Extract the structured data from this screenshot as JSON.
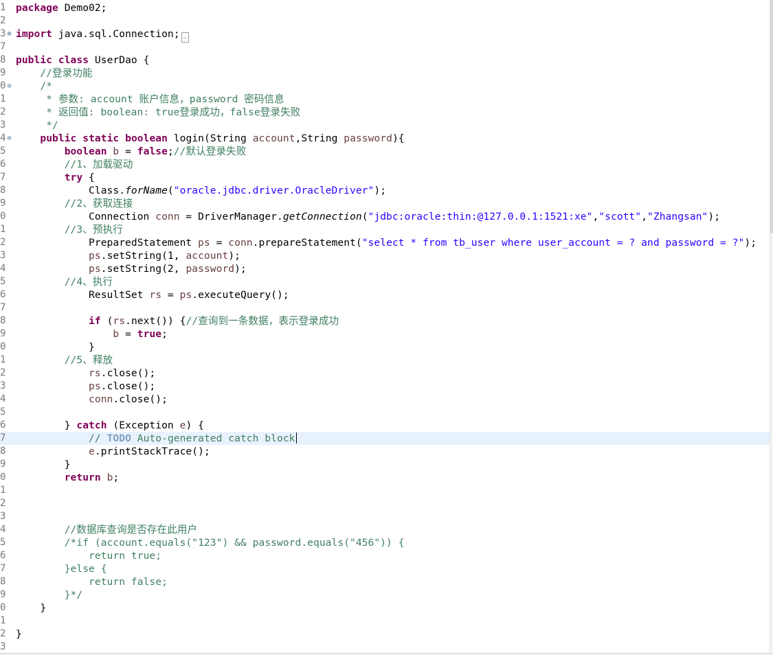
{
  "editor": {
    "language": "java",
    "current_line_index": 33,
    "lines": [
      {
        "ln": "1",
        "code": "<span class=\"kw\">package</span> Demo02;"
      },
      {
        "ln": "2",
        "code": ""
      },
      {
        "ln": "3",
        "marker": "⊕",
        "code": "<span class=\"kw\">import</span> java.sql.Connection;<span class=\"fold\">…</span>"
      },
      {
        "ln": "7",
        "code": ""
      },
      {
        "ln": "8",
        "code": "<span class=\"kw\">public</span> <span class=\"kw\">class</span> UserDao {"
      },
      {
        "ln": "9",
        "code": "    <span class=\"cm\">//登录功能</span>"
      },
      {
        "ln": "0",
        "marker": "⊖",
        "code": "    <span class=\"cm\">/*</span>"
      },
      {
        "ln": "1",
        "code": "     <span class=\"cm\">* 参数: account 账户信息，password 密码信息</span>"
      },
      {
        "ln": "2",
        "code": "     <span class=\"cm\">* 返回值: boolean: true登录成功，false登录失败</span>"
      },
      {
        "ln": "3",
        "code": "     <span class=\"cm\">*/</span>"
      },
      {
        "ln": "4",
        "marker": "⊖",
        "code": "    <span class=\"kw\">public</span> <span class=\"kw\">static</span> <span class=\"kw\">boolean</span> login(String <span class=\"var\">account</span>,String <span class=\"var\">password</span>){"
      },
      {
        "ln": "5",
        "code": "        <span class=\"kw\">boolean</span> <span class=\"var\">b</span> = <span class=\"kw\">false</span>;<span class=\"cm\">//默认登录失败</span>"
      },
      {
        "ln": "6",
        "code": "        <span class=\"cm\">//1、加载驱动</span>"
      },
      {
        "ln": "7",
        "code": "        <span class=\"kw\">try</span> {"
      },
      {
        "ln": "8",
        "code": "            Class.<span class=\"it\">forName</span>(<span class=\"str\">\"oracle.jdbc.driver.OracleDriver\"</span>);"
      },
      {
        "ln": "9",
        "code": "        <span class=\"cm\">//2、获取连接</span>"
      },
      {
        "ln": "0",
        "code": "            Connection <span class=\"var\">conn</span> = DriverManager.<span class=\"it\">getConnection</span>(<span class=\"str\">\"jdbc:oracle:thin:@127.0.0.1:1521:xe\"</span>,<span class=\"str\">\"scott\"</span>,<span class=\"str\">\"Zhangsan\"</span>);"
      },
      {
        "ln": "1",
        "code": "        <span class=\"cm\">//3、预执行</span>"
      },
      {
        "ln": "2",
        "code": "            PreparedStatement <span class=\"var\">ps</span> = <span class=\"var\">conn</span>.prepareStatement(<span class=\"str\">\"select * from tb_user where user_account = ? and password = ?\"</span>);"
      },
      {
        "ln": "3",
        "code": "            <span class=\"var\">ps</span>.setString(1, <span class=\"var\">account</span>);"
      },
      {
        "ln": "4",
        "code": "            <span class=\"var\">ps</span>.setString(2, <span class=\"var\">password</span>);"
      },
      {
        "ln": "5",
        "code": "        <span class=\"cm\">//4、执行</span>"
      },
      {
        "ln": "6",
        "code": "            ResultSet <span class=\"var\">rs</span> = <span class=\"var\">ps</span>.executeQuery();"
      },
      {
        "ln": "7",
        "code": ""
      },
      {
        "ln": "8",
        "code": "            <span class=\"kw\">if</span> (<span class=\"var\">rs</span>.next()) {<span class=\"cm\">//查询到一条数据，表示登录成功</span>"
      },
      {
        "ln": "9",
        "code": "                <span class=\"var\">b</span> = <span class=\"kw\">true</span>;"
      },
      {
        "ln": "0",
        "code": "            }"
      },
      {
        "ln": "1",
        "code": "        <span class=\"cm\">//5、释放</span>"
      },
      {
        "ln": "2",
        "code": "            <span class=\"var\">rs</span>.close();"
      },
      {
        "ln": "3",
        "code": "            <span class=\"var\">ps</span>.close();"
      },
      {
        "ln": "4",
        "code": "            <span class=\"var\">conn</span>.close();"
      },
      {
        "ln": "5",
        "code": ""
      },
      {
        "ln": "6",
        "code": "        } <span class=\"kw\">catch</span> (Exception <span class=\"var\">e</span>) {"
      },
      {
        "ln": "7",
        "code": "            <span class=\"cm\">// </span><span class=\"todo\">TODO</span><span class=\"cm\"> Auto-generated catch block</span><span class=\"caret\"></span>"
      },
      {
        "ln": "8",
        "code": "            <span class=\"var\">e</span>.printStackTrace();"
      },
      {
        "ln": "9",
        "code": "        }"
      },
      {
        "ln": "0",
        "code": "        <span class=\"kw\">return</span> <span class=\"var\">b</span>;"
      },
      {
        "ln": "1",
        "code": ""
      },
      {
        "ln": "2",
        "code": ""
      },
      {
        "ln": "3",
        "code": ""
      },
      {
        "ln": "4",
        "code": "        <span class=\"cm\">//数据库查询是否存在此用户</span>"
      },
      {
        "ln": "5",
        "code": "        <span class=\"cm\">/*if (account.equals(\"123\") &amp;&amp; password.equals(\"456\")) {</span>"
      },
      {
        "ln": "6",
        "code": "            <span class=\"cm\">return true;</span>"
      },
      {
        "ln": "7",
        "code": "        <span class=\"cm\">}else {</span>"
      },
      {
        "ln": "8",
        "code": "            <span class=\"cm\">return false;</span>"
      },
      {
        "ln": "9",
        "code": "        <span class=\"cm\">}*/</span>"
      },
      {
        "ln": "0",
        "code": "    }"
      },
      {
        "ln": "1",
        "code": ""
      },
      {
        "ln": "2",
        "code": "}"
      },
      {
        "ln": "3",
        "code": ""
      }
    ]
  }
}
